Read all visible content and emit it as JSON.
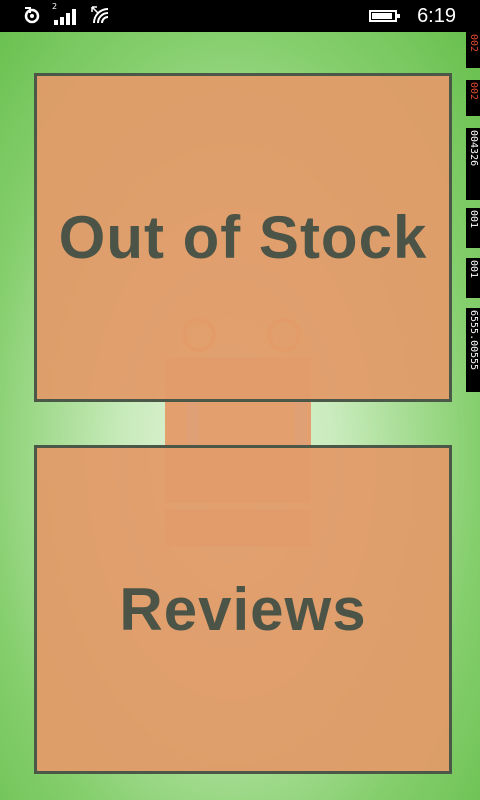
{
  "status_bar": {
    "time": "6:19",
    "sim_number": "2"
  },
  "tiles": {
    "out_of_stock": "Out of Stock",
    "reviews": "Reviews"
  },
  "counters": [
    {
      "value": "002",
      "color": "red"
    },
    {
      "value": "002",
      "color": "red"
    },
    {
      "value": "004326",
      "color": "white"
    },
    {
      "value": "001",
      "color": "white"
    },
    {
      "value": "001",
      "color": "white"
    },
    {
      "value": "6555.00555",
      "color": "white"
    }
  ]
}
